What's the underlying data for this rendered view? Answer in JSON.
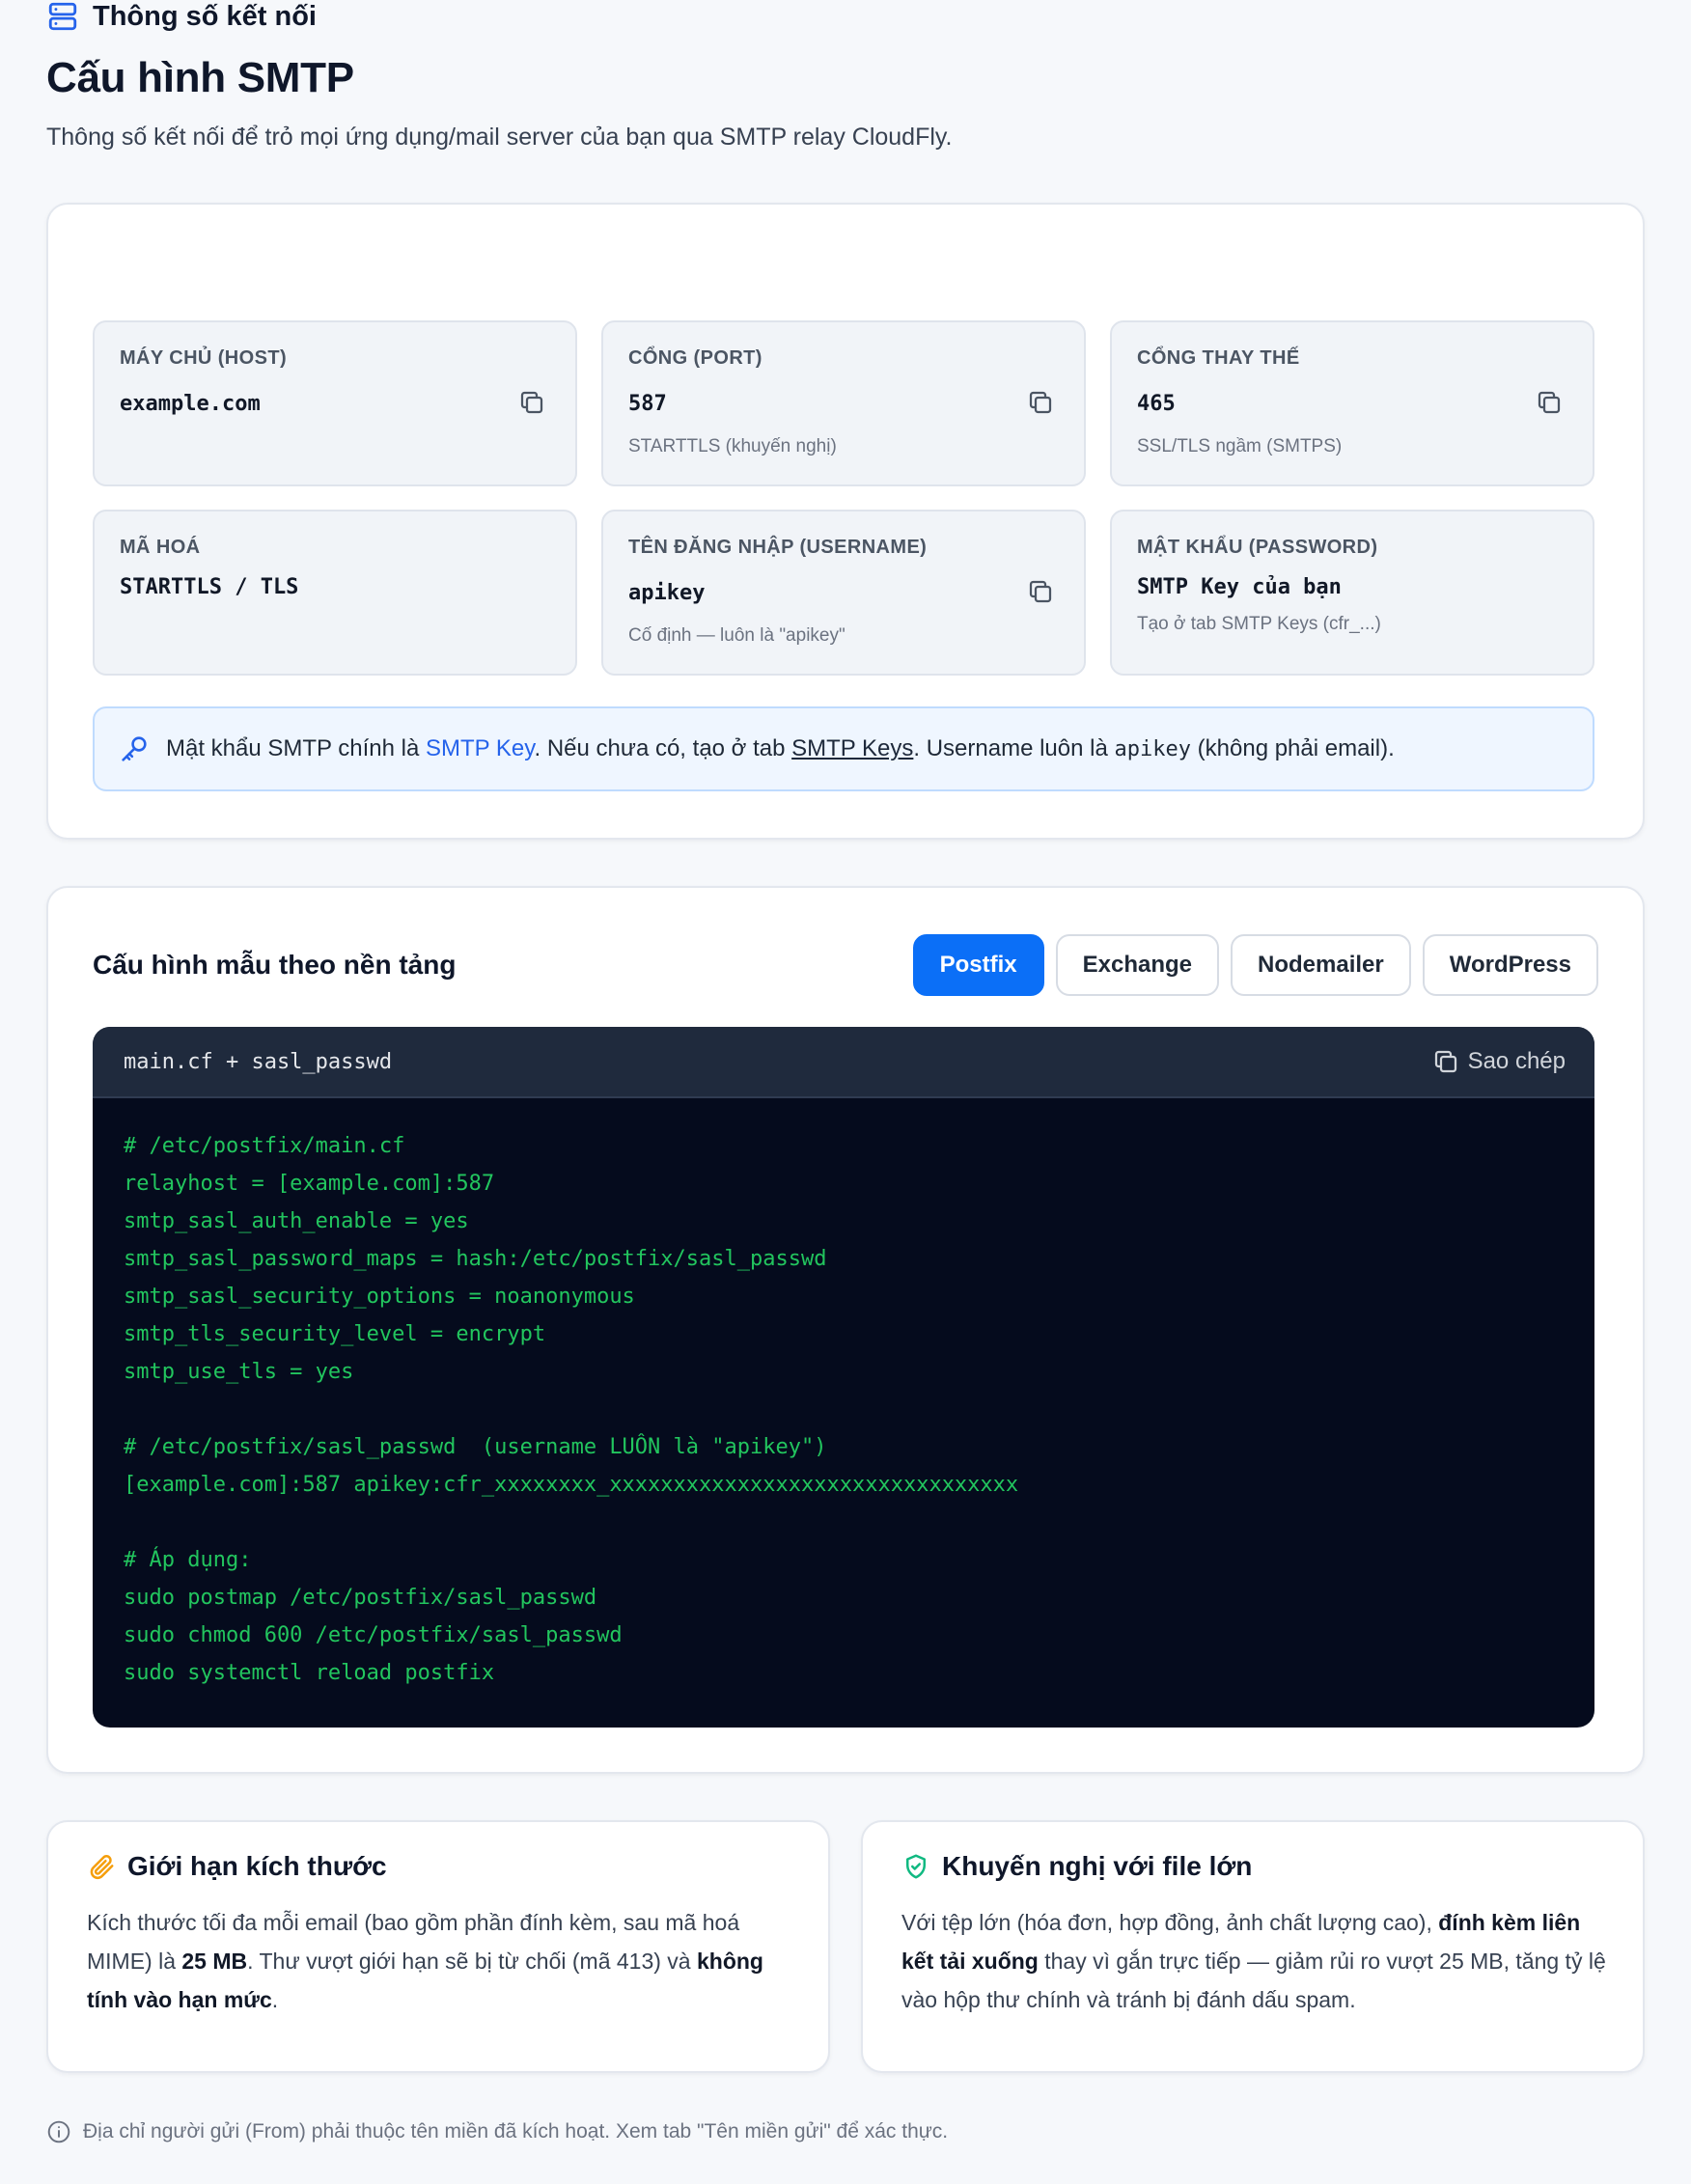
{
  "header": {
    "title": "Cấu hình SMTP",
    "subtitle": "Thông số kết nối để trỏ mọi ứng dụng/mail server của bạn qua SMTP relay CloudFly."
  },
  "connection": {
    "heading": "Thông số kết nối",
    "tiles": [
      {
        "label": "MÁY CHỦ (HOST)",
        "value": "example.com",
        "note": ""
      },
      {
        "label": "CỔNG (PORT)",
        "value": "587",
        "note": "STARTTLS (khuyến nghị)"
      },
      {
        "label": "CỔNG THAY THẾ",
        "value": "465",
        "note": "SSL/TLS ngầm (SMTPS)"
      },
      {
        "label": "MÃ HOÁ",
        "value": "STARTTLS / TLS",
        "note": ""
      },
      {
        "label": "TÊN ĐĂNG NHẬP (USERNAME)",
        "value": "apikey",
        "note": "Cố định — luôn là \"apikey\""
      },
      {
        "label": "MẬT KHẨU (PASSWORD)",
        "value": "SMTP Key của bạn",
        "note": "Tạo ở tab SMTP Keys (cfr_...)"
      }
    ],
    "alert": {
      "t1": "Mật khẩu SMTP chính là ",
      "link": "SMTP Key",
      "t2": ". Nếu chưa có, tạo ở tab ",
      "tab_link": "SMTP Keys",
      "t3": ". Username luôn là ",
      "code": "apikey",
      "t4": " (không phải email)."
    }
  },
  "samples": {
    "heading": "Cấu hình mẫu theo nền tảng",
    "tabs": [
      "Postfix",
      "Exchange",
      "Nodemailer",
      "WordPress"
    ],
    "active_tab": "Postfix",
    "file_name": "main.cf + sasl_passwd",
    "copy_label": "Sao chép",
    "code": "# /etc/postfix/main.cf\nrelayhost = [example.com]:587\nsmtp_sasl_auth_enable = yes\nsmtp_sasl_password_maps = hash:/etc/postfix/sasl_passwd\nsmtp_sasl_security_options = noanonymous\nsmtp_tls_security_level = encrypt\nsmtp_use_tls = yes\n\n# /etc/postfix/sasl_passwd  (username LUÔN là \"apikey\")\n[example.com]:587 apikey:cfr_xxxxxxxx_xxxxxxxxxxxxxxxxxxxxxxxxxxxxxxxx\n\n# Áp dụng:\nsudo postmap /etc/postfix/sasl_passwd\nsudo chmod 600 /etc/postfix/sasl_passwd\nsudo systemctl reload postfix"
  },
  "limit": {
    "heading": "Giới hạn kích thước",
    "t1": "Kích thước tối đa mỗi email (bao gồm phần đính kèm, sau mã hoá MIME) là ",
    "b1": "25 MB",
    "t2": ". Thư vượt giới hạn sẽ bị từ chối (mã 413) và ",
    "b2": "không tính vào hạn mức",
    "t3": "."
  },
  "recommend": {
    "heading": "Khuyến nghị với file lớn",
    "t1": "Với tệp lớn (hóa đơn, hợp đồng, ảnh chất lượng cao), ",
    "b1": "đính kèm liên kết tải xuống",
    "t2": " thay vì gắn trực tiếp — giảm rủi ro vượt 25 MB, tăng tỷ lệ vào hộp thư chính và tránh bị đánh dấu spam."
  },
  "footnote": "Địa chỉ người gửi (From) phải thuộc tên miền đã kích hoạt. Xem tab \"Tên miền gửi\" để xác thực.",
  "icons": {
    "server": "server-icon",
    "copy": "copy-icon",
    "key": "key-icon",
    "paperclip": "paperclip-icon",
    "shield": "shield-check-icon",
    "info": "info-icon"
  },
  "colors": {
    "accent": "#0b6ff7",
    "code_bg": "#050b1d",
    "code_text": "#22c55e",
    "alert_bg": "#eff6ff",
    "shield": "#10b981",
    "paperclip": "#f59e0b"
  }
}
